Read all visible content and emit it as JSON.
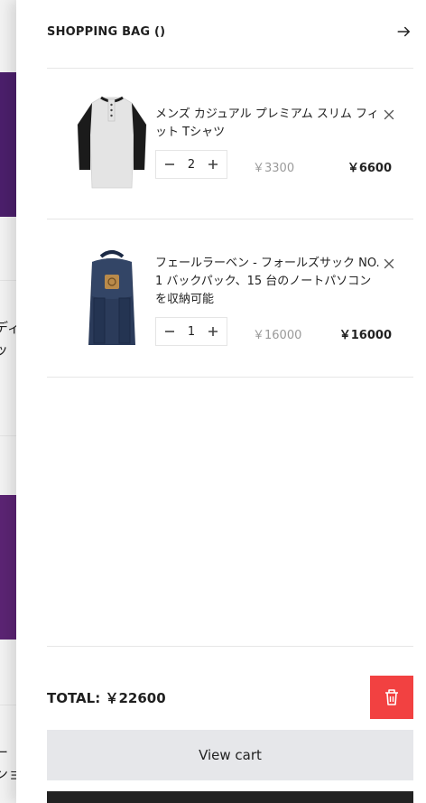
{
  "background": {
    "text1": "ディ",
    "text2": "ッ",
    "text3": "ー",
    "text4": "ンョ"
  },
  "cart": {
    "title": "SHOPPING BAG ()",
    "items": [
      {
        "name": "メンズ カジュアル プレミアム スリム フィット Tシャツ",
        "qty": "2",
        "unit_price": "￥3300",
        "line_total": "￥6600",
        "image": "henley-shirt"
      },
      {
        "name": "フェールラーベン - フォールズサック NO. 1 バックパック、15 台のノートパソコンを収納可能",
        "qty": "1",
        "unit_price": "￥16000",
        "line_total": "￥16000",
        "image": "backpack"
      }
    ],
    "total_label": "TOTAL:",
    "total_value": "￥22600",
    "view_cart_label": "View cart"
  },
  "colors": {
    "delete_button": "#f24141",
    "view_cart_bg": "#e6e7ea",
    "checkout_bg": "#222222"
  },
  "icons": {
    "close": "arrow-right-icon",
    "remove": "close-x-icon",
    "minus": "minus-icon",
    "plus": "plus-icon",
    "trash": "trash-icon"
  }
}
